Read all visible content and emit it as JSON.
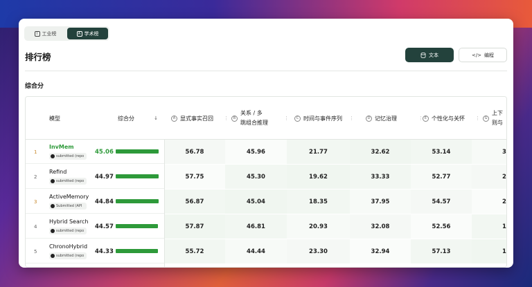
{
  "tabs": [
    {
      "glyph": "I",
      "label": "工业榜",
      "active": false
    },
    {
      "glyph": "A",
      "label": "学术榜",
      "active": true
    }
  ],
  "page_title": "排行榜",
  "toolbar": {
    "text_label": "文本",
    "edit_label": "编程"
  },
  "section_title": "综合分",
  "table": {
    "model_header": "模型",
    "score_header": "综合分",
    "sort_glyph": "↓",
    "columns": [
      {
        "glyph": "A",
        "label": "显式事实召回"
      },
      {
        "glyph": "B",
        "label": "关系 / 多\n跳组合推理"
      },
      {
        "glyph": "C",
        "label": "时间与事件序列"
      },
      {
        "glyph": "D",
        "label": "记忆治理"
      },
      {
        "glyph": "E",
        "label": "个性化与关怀"
      },
      {
        "glyph": "G",
        "label": "上下\n则与"
      }
    ],
    "rows": [
      {
        "rank": "1",
        "name": "InvMem",
        "badge": "submitted (repo",
        "score": "45.06",
        "fraction": 1.0,
        "values": [
          "56.78",
          "45.96",
          "21.77",
          "32.62",
          "53.14",
          "3"
        ]
      },
      {
        "rank": "2",
        "name": "Refind",
        "badge": "submitted (repo",
        "score": "44.97",
        "fraction": 0.998,
        "values": [
          "57.75",
          "45.30",
          "19.62",
          "33.33",
          "52.77",
          "2"
        ]
      },
      {
        "rank": "3",
        "name": "ActiveMemory",
        "badge": "Submitted (API",
        "score": "44.84",
        "fraction": 0.995,
        "values": [
          "56.87",
          "45.04",
          "18.35",
          "37.95",
          "54.57",
          "2"
        ]
      },
      {
        "rank": "4",
        "name": "Hybrid Search",
        "badge": "submitted (repo",
        "score": "44.57",
        "fraction": 0.989,
        "values": [
          "57.87",
          "46.81",
          "20.93",
          "32.08",
          "52.56",
          "1"
        ]
      },
      {
        "rank": "5",
        "name": "ChronoHybrid",
        "badge": "submitted (repo",
        "score": "44.33",
        "fraction": 0.984,
        "values": [
          "55.72",
          "44.44",
          "23.30",
          "32.94",
          "57.13",
          "1"
        ]
      }
    ]
  },
  "colors": {
    "accent_dark": "#23423c",
    "green": "#2e9a3a",
    "rank_highlight": "#c7882a"
  }
}
